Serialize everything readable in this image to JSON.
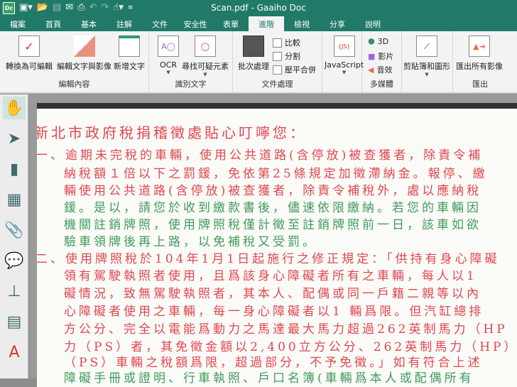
{
  "window": {
    "title": "Scan.pdf - Gaaiho Doc",
    "logo": "Dc"
  },
  "tabs": [
    "檔案",
    "首頁",
    "基本",
    "註解",
    "文件",
    "安全性",
    "表單",
    "進階",
    "檢視",
    "分享",
    "說明"
  ],
  "active_tab": "進階",
  "ribbon": {
    "edit_group": {
      "label": "編輯內容",
      "buttons": [
        "轉換為可編輯",
        "編輯文字與影像",
        "新增文字"
      ]
    },
    "ocr_group": {
      "label": "識別文字",
      "buttons": [
        "OCR",
        "尋找可疑元素"
      ]
    },
    "doc_group": {
      "label": "文件處理",
      "batch": "批次處理",
      "compare": "比較",
      "split": "分割",
      "flatten": "壓平合併"
    },
    "js_group": {
      "button": "JavaScript"
    },
    "media_group": {
      "label": "多媒體",
      "items": [
        "3D",
        "影片",
        "音效"
      ]
    },
    "clip_group": {
      "button": "剪貼簿和圖形"
    },
    "export_group": {
      "label": "匯出",
      "button": "匯出所有影像"
    }
  },
  "document": {
    "lines": [
      {
        "text": "新北市政府稅捐稽徵處貼心叮嚀您：",
        "color": "red"
      },
      {
        "text": "一、逾期未完稅的車輛，使用公共道路(含停放)被查獲者，除責令補",
        "color": "red"
      },
      {
        "text": "納稅額１倍以下之罰鍰，免依第25條規定加徵滯納金。報停、繳",
        "color": "red"
      },
      {
        "text": "輛使用公共道路(含停放)被查獲者，除責令補稅外，處以應納稅",
        "color": "red"
      },
      {
        "text": "鍰。是以，請您於收到繳款書後，儘速依限繳納。若您的車輛因",
        "color": "green"
      },
      {
        "text": "機關註銷牌照，使用牌照稅僅計徵至註銷牌照前一日，該車如欲",
        "color": "green"
      },
      {
        "text": "驗車領牌後再上路，以免補稅又受罰。",
        "color": "green"
      },
      {
        "text": "二、使用牌照稅於104年1月1日起施行之修正規定：「供持有身心障礙",
        "color": "red"
      },
      {
        "text": "領有駕駛執照者使用，且爲該身心障礙者所有之車輛，每人以1",
        "color": "red"
      },
      {
        "text": "礙情況，致無駕駛執照者，其本人、配偶或同一戶籍二親等以內",
        "color": "red"
      },
      {
        "text": "心障礙者使用之車輛，每一身心障礙者以1 輛爲限。但汽缸總排",
        "color": "red"
      },
      {
        "text": "方公分、完全以電能爲動力之馬達最大馬力超過262英制馬力（HP",
        "color": "red"
      },
      {
        "text": "力（PS）者，其免徵金額以2,400立方公分、262英制馬力（HP）",
        "color": "red"
      },
      {
        "text": "（PS）車輛之稅額爲限，超過部分，不予免徵。」如有符合上述",
        "color": "red"
      },
      {
        "text": "障礙手冊或證明、行車執照、戶口名簿(車輛爲本人或配偶所有",
        "color": "green"
      }
    ]
  },
  "colors": {
    "brand": "#217a68",
    "red_text": "#e0474f",
    "green_text": "#3f9b5c"
  }
}
